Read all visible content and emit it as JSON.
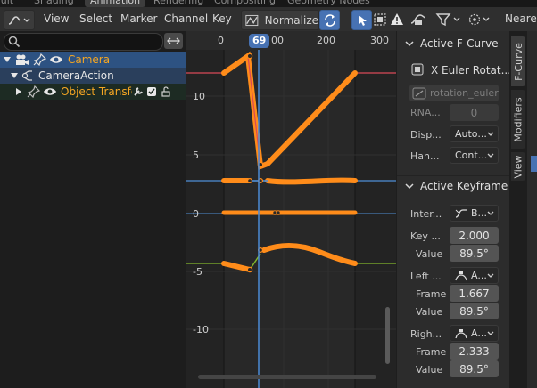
{
  "workspace_tabs": [
    "ault",
    "Shading",
    "Animation",
    "Rendering",
    "Compositing",
    "Geometry Nodes"
  ],
  "header": {
    "menus": [
      "View",
      "Select",
      "Marker",
      "Channel",
      "Key"
    ],
    "normalize_label": "Normalize",
    "pivot_label": "Neare"
  },
  "channels": {
    "search_placeholder": "",
    "rows": [
      {
        "label": "Camera"
      },
      {
        "label": "CameraAction"
      },
      {
        "label": "Object Transform"
      }
    ]
  },
  "graph": {
    "frame_ticks": [
      "0",
      "69",
      "00",
      "200",
      "300"
    ],
    "current_frame": "69",
    "value_ticks": [
      "10",
      "5",
      "0",
      "-5",
      "-10"
    ]
  },
  "sidebar": {
    "fcurve": {
      "title": "Active F-Curve",
      "name": "X Euler Rotat...",
      "data_path": "rotation_euler",
      "rna_label": "RNA...",
      "rna_value": "0",
      "display_label": "Disp...",
      "display_value": "Auto...",
      "handle_label": "Han...",
      "handle_value": "Cont..."
    },
    "keyframe": {
      "title": "Active Keyframe",
      "interp_label": "Inter...",
      "interp_value": "B...",
      "key_label": "Key ...",
      "key_frame": "2.000",
      "value_label": "Value",
      "key_value": "89.5°",
      "left_label": "Left ...",
      "left_handle": "A...",
      "left_frame_label": "Frame",
      "left_frame": "1.667",
      "left_value_label": "Value",
      "left_value": "89.5°",
      "right_label": "Righ...",
      "right_handle": "A...",
      "right_frame_label": "Frame",
      "right_frame": "2.333",
      "right_value_label": "Value",
      "right_value": "89.5°"
    },
    "tabs": [
      "F-Curve",
      "Modifiers",
      "View"
    ]
  },
  "colors": {
    "accent": "#4772b3",
    "curve_selected": "#ff8c1a",
    "x_axis_curve": "#d94a57",
    "z_axis_curve": "#4f8fd6",
    "y_axis_curve": "#83b82c",
    "selected_text": "#f5a623"
  }
}
